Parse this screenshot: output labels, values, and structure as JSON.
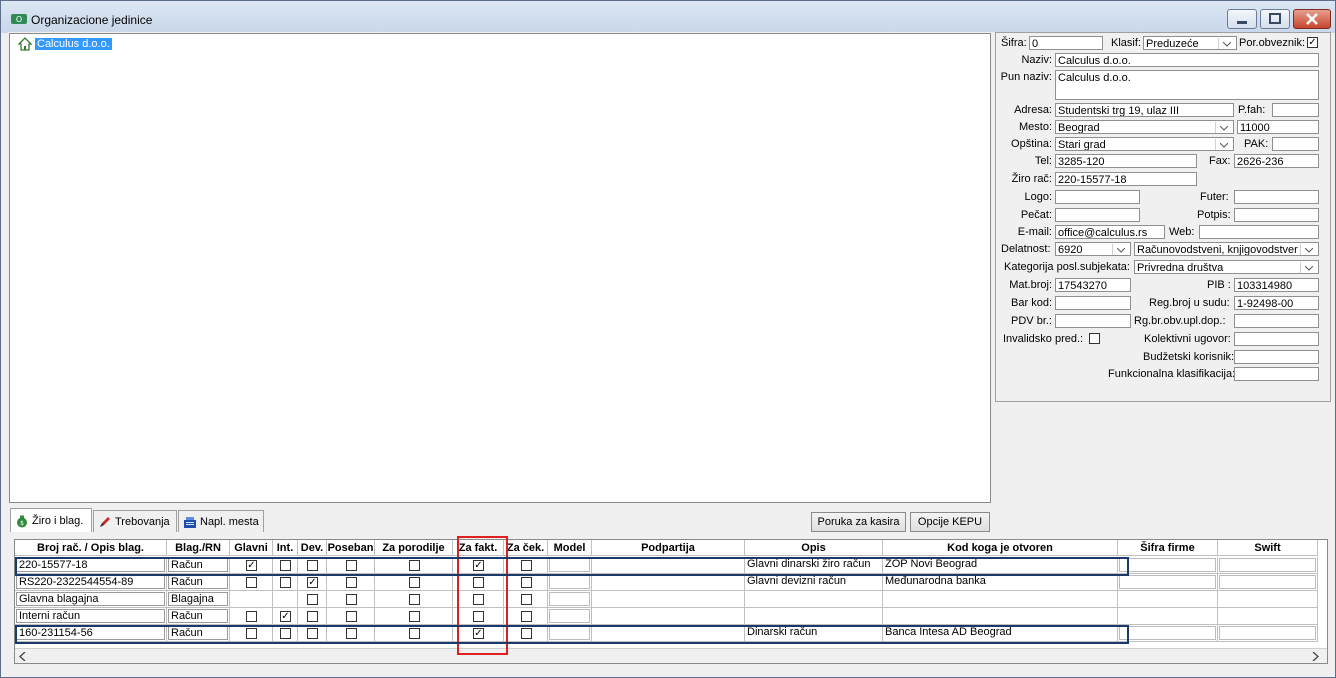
{
  "window": {
    "title": "Organizacione jedinice"
  },
  "tree": {
    "root": "Calculus d.o.o."
  },
  "form": {
    "sifra_label": "Šifra:",
    "sifra": "0",
    "klasif_label": "Klasif:",
    "klasif": "Preduzeće",
    "por_label": "Por.obveznik:",
    "por_mark": "✓",
    "naziv_label": "Naziv:",
    "naziv": "Calculus d.o.o.",
    "pun_naziv_label": "Pun naziv:",
    "pun_naziv": "Calculus d.o.o.",
    "adresa_label": "Adresa:",
    "adresa": "Studentski trg 19, ulaz III",
    "pfah_label": "P.fah:",
    "pfah": "",
    "mesto_label": "Mesto:",
    "mesto": "Beograd",
    "postanski": "11000",
    "opstina_label": "Opština:",
    "opstina": "Stari grad",
    "pak_label": "PAK:",
    "pak": "",
    "tel_label": "Tel:",
    "tel": "3285-120",
    "fax_label": "Fax:",
    "fax": "2626-236",
    "ziro_label": "Žiro rač:",
    "ziro": "220-15577-18",
    "logo_label": "Logo:",
    "futer_label": "Futer:",
    "pecat_label": "Pečat:",
    "potpis_label": "Potpis:",
    "email_label": "E-mail:",
    "email": "office@calculus.rs",
    "web_label": "Web:",
    "web": "",
    "delatnost_label": "Delatnost:",
    "delatnost_code": "6920",
    "delatnost_desc": "Računovodstveni, knjigovodstver",
    "kategorija_label": "Kategorija posl.subjekata:",
    "kategorija": "Privredna društva",
    "matbroj_label": "Mat.broj:",
    "matbroj": "17543270",
    "pib_label": "PIB :",
    "pib": "103314980",
    "barkod_label": "Bar kod:",
    "barkod": "",
    "regbroj_label": "Reg.broj u sudu:",
    "regbroj": "1-92498-00",
    "pdv_label": "PDV br.:",
    "pdv": "",
    "rgbr_label": "Rg.br.obv.upl.dop.:",
    "rgbr": "",
    "invalid_label": "Invalidsko pred.:",
    "kolektivni_label": "Kolektivni ugovor:",
    "budzetski_label": "Budžetski korisnik:",
    "funkcionalna_label": "Funkcionalna klasifikacija:"
  },
  "tabs": [
    {
      "label": "Žiro i blag."
    },
    {
      "label": "Trebovanja"
    },
    {
      "label": "Napl. mesta"
    }
  ],
  "buttons": {
    "poruka": "Poruka za kasira",
    "opcije": "Opcije KEPU"
  },
  "grid": {
    "headers": [
      "Broj rač. / Opis blag.",
      "Blag./RN",
      "Glavni",
      "Int.",
      "Dev.",
      "Poseban",
      "Za porodilje",
      "Za fakt.",
      "Za ček.",
      "Model",
      "Podpartija",
      "Opis",
      "Kod koga je otvoren",
      "Šifra firme",
      "Swift"
    ],
    "check_mark": "✓",
    "rows": [
      {
        "broj": "220-15577-18",
        "blag": "Račun",
        "opis": "Glavni dinarski žiro račun",
        "kod": "ZOP Novi Beograd"
      },
      {
        "broj": "RS220-2322544554-89",
        "blag": "Račun",
        "opis": "Glavni devizni račun",
        "kod": "Međunarodna banka"
      },
      {
        "broj": "Glavna blagajna",
        "blag": "Blagajna",
        "opis": "",
        "kod": ""
      },
      {
        "broj": "Interni račun",
        "blag": "Račun",
        "opis": "",
        "kod": ""
      },
      {
        "broj": "160-231154-56",
        "blag": "Račun",
        "opis": "Dinarski račun",
        "kod": "Banca Intesa AD Beograd"
      }
    ]
  }
}
